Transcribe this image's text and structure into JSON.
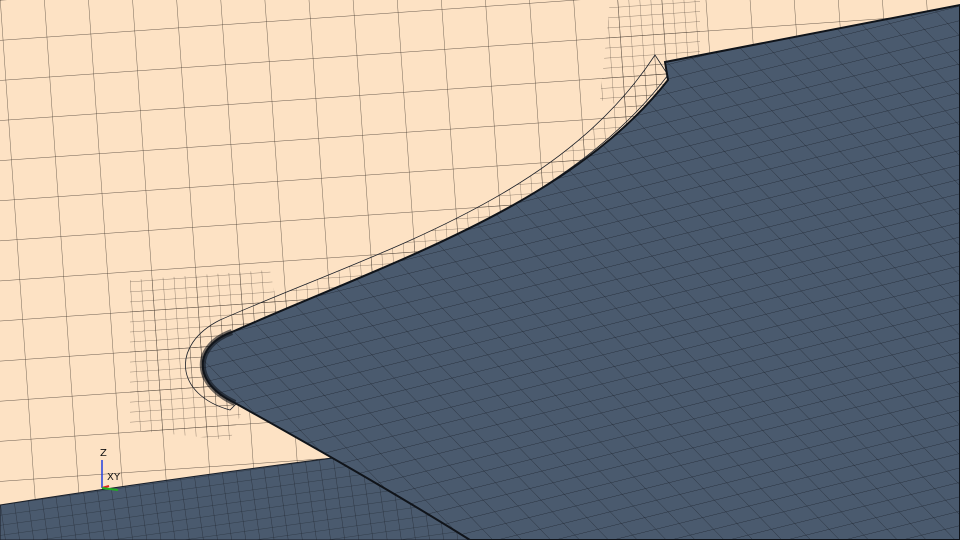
{
  "viewport": {
    "colors": {
      "flow_domain": "#fde2c4",
      "wing_surface": "#4a5a6e",
      "mesh_lines": "#1a1f28"
    },
    "axes_triad": {
      "z_label": "Z",
      "x_label": "X",
      "y_label": "Y",
      "colors": {
        "x": "#e02020",
        "y": "#20b020",
        "z": "#2040e0"
      }
    }
  }
}
